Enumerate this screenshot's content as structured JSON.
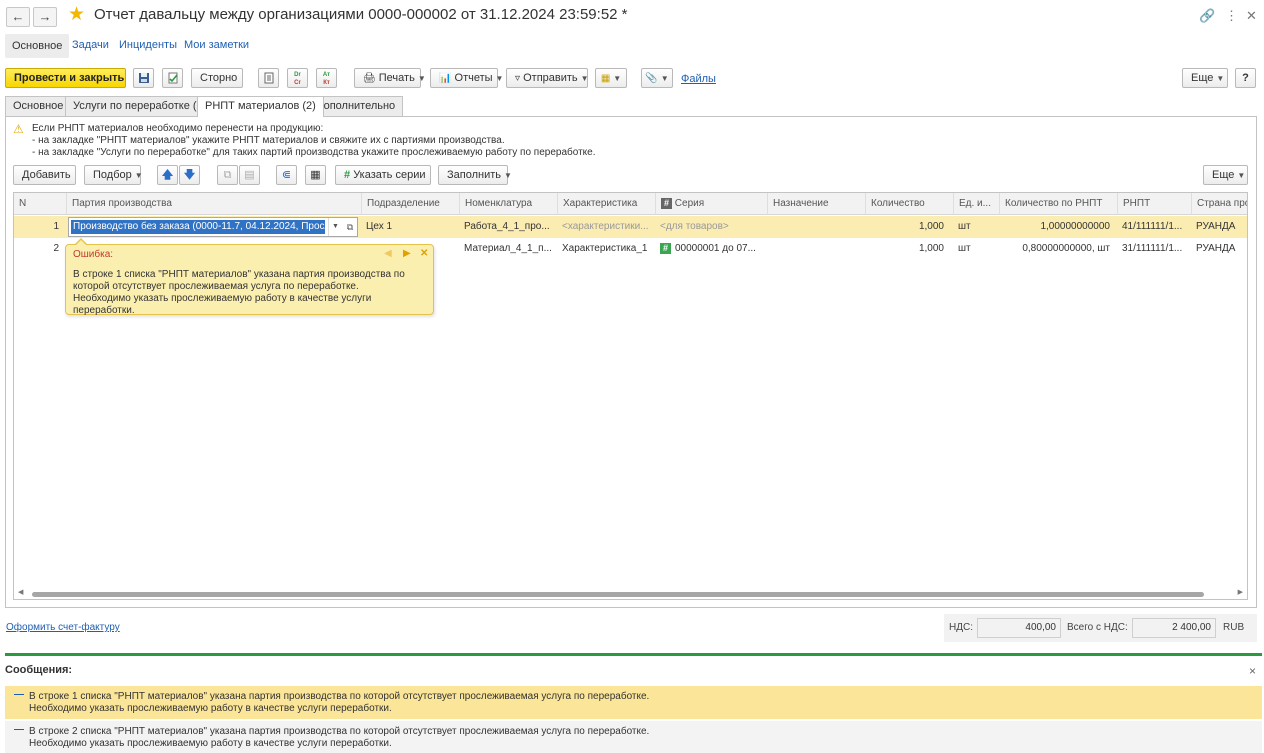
{
  "window": {
    "title": "Отчет давальцу между организациями 0000-000002 от 31.12.2024 23:59:52 *"
  },
  "sections": {
    "main": "Основное",
    "tasks": "Задачи",
    "incidents": "Инциденты",
    "notes": "Мои заметки"
  },
  "toolbar": {
    "post_close": "Провести и закрыть",
    "storno": "Сторно",
    "print": "Печать",
    "reports": "Отчеты",
    "send": "Отправить",
    "files": "Файлы",
    "more": "Еще",
    "help": "?",
    "dt_label": "Dr",
    "kt_label": "Cr",
    "at_label": "Ат",
    "kt2_label": "Кт"
  },
  "tabs": [
    {
      "label": "Основное"
    },
    {
      "label": "Услуги по переработке (2)"
    },
    {
      "label": "РНПТ материалов (2)"
    },
    {
      "label": "Дополнительно"
    }
  ],
  "notice": {
    "line1": "Если РНПТ материалов необходимо перенести на продукцию:",
    "line2": "- на закладке \"РНПТ материалов\" укажите РНПТ материалов и свяжите их с партиями производства.",
    "line3": "- на закладке \"Услуги по переработке\" для таких партий производства укажите прослеживаемую работу по переработке."
  },
  "table_toolbar": {
    "add": "Добавить",
    "pick": "Подбор",
    "series": "Указать серии",
    "fill": "Заполнить",
    "more": "Еще"
  },
  "table": {
    "columns": [
      "N",
      "Партия производства",
      "Подразделение",
      "Номенклатура",
      "Характеристика",
      "Серия",
      "Назначение",
      "Количество",
      "Ед. и...",
      "Количество по РНПТ",
      "РНПТ",
      "Страна про"
    ],
    "rows": [
      {
        "n": "1",
        "batch": "Производство без заказа (0000-11.7, 04.12.2024, Просле",
        "division": "Цех 1",
        "nomenclature": "Работа_4_1_про...",
        "characteristic": "<характеристики...",
        "series": "<для товаров>",
        "purpose": "",
        "qty": "1,000",
        "unit": "шт",
        "qty_rnpt": "1,00000000000",
        "rnpt": "41/111111/1...",
        "country": "РУАНДА"
      },
      {
        "n": "2",
        "batch": "",
        "division": "",
        "nomenclature": "Материал_4_1_п...",
        "characteristic": "Характеристика_1",
        "series": "00000001 до 07...",
        "purpose": "",
        "qty": "1,000",
        "unit": "шт",
        "qty_rnpt": "0,80000000000, шт",
        "rnpt": "31/111111/1...",
        "country": "РУАНДА"
      }
    ]
  },
  "error_popup": {
    "title": "Ошибка:",
    "line1": "В строке 1 списка \"РНПТ материалов\" указана партия производства по",
    "line2": "которой отсутствует прослеживаемая услуга по переработке.",
    "line3": "Необходимо указать прослеживаемую работу в качестве услуги переработки."
  },
  "footer": {
    "invoice_link": "Оформить счет-фактуру",
    "vat_label": "НДС:",
    "vat_value": "400,00",
    "total_label": "Всего с НДС:",
    "total_value": "2 400,00",
    "currency": "RUB"
  },
  "messages": {
    "title": "Сообщения:",
    "close": "×",
    "items": [
      {
        "line1": "В строке 1 списка \"РНПТ материалов\" указана партия производства по которой отсутствует прослеживаемая услуга по переработке.",
        "line2": "Необходимо указать прослеживаемую работу в качестве услуги переработки."
      },
      {
        "line1": "В строке 2 списка \"РНПТ материалов\" указана партия производства по которой отсутствует прослеживаемая услуга по переработке.",
        "line2": "Необходимо указать прослеживаемую работу в качестве услуги переработки."
      }
    ]
  },
  "colors": {
    "accent_yellow": "#f7d600",
    "link_blue": "#1f5fb0",
    "selected_row": "#fbecb2",
    "messages_green": "#2a9a3f",
    "error_bg": "#fbefb0"
  }
}
